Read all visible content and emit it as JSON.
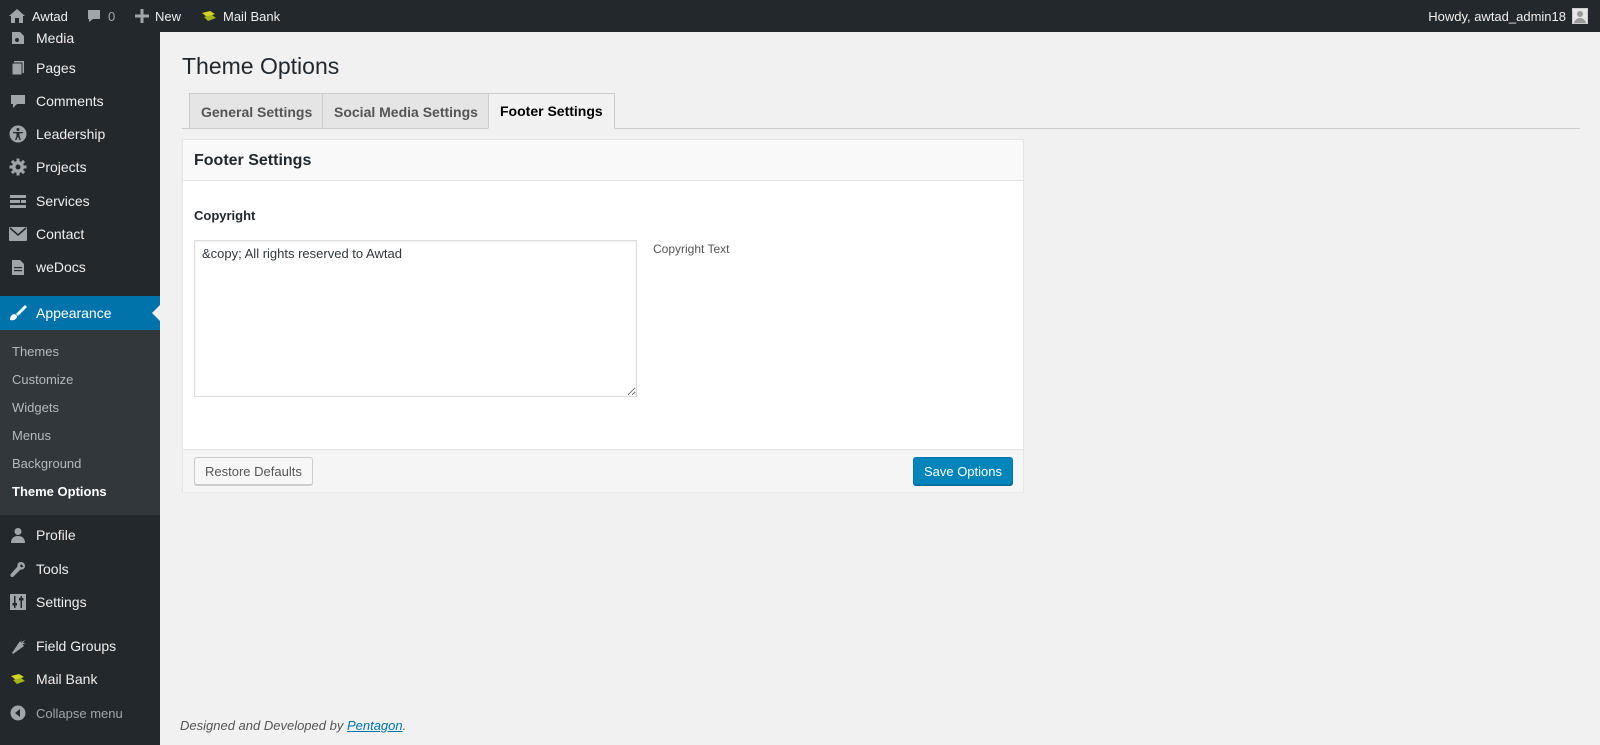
{
  "adminbar": {
    "site_name": "Awtad",
    "comments_count": "0",
    "new_label": "New",
    "mailbank_label": "Mail Bank",
    "howdy": "Howdy, awtad_admin18"
  },
  "sidebar": {
    "items": [
      {
        "label": "Media",
        "icon": "media-icon"
      },
      {
        "label": "Pages",
        "icon": "pages-icon"
      },
      {
        "label": "Comments",
        "icon": "comment-icon"
      },
      {
        "label": "Leadership",
        "icon": "accessibility-icon"
      },
      {
        "label": "Projects",
        "icon": "gear-icon"
      },
      {
        "label": "Services",
        "icon": "services-icon"
      },
      {
        "label": "Contact",
        "icon": "mail-icon"
      },
      {
        "label": "weDocs",
        "icon": "document-icon"
      },
      {
        "label": "Appearance",
        "icon": "paintbrush-icon"
      },
      {
        "label": "Profile",
        "icon": "user-icon"
      },
      {
        "label": "Tools",
        "icon": "wrench-icon"
      },
      {
        "label": "Settings",
        "icon": "sliders-icon"
      },
      {
        "label": "Field Groups",
        "icon": "carrot-icon"
      },
      {
        "label": "Mail Bank",
        "icon": "mailbank-icon"
      },
      {
        "label": "Collapse menu",
        "icon": "collapse-icon"
      }
    ],
    "submenu": [
      "Themes",
      "Customize",
      "Widgets",
      "Menus",
      "Background",
      "Theme Options"
    ]
  },
  "main": {
    "title": "Theme Options",
    "tabs": [
      "General Settings",
      "Social Media Settings",
      "Footer Settings"
    ],
    "panel": {
      "title": "Footer Settings",
      "field_label": "Copyright",
      "field_value": "&copy; All rights reserved to Awtad",
      "field_desc": "Copyright Text",
      "restore_label": "Restore Defaults",
      "save_label": "Save Options"
    }
  },
  "footer": {
    "prefix": "Designed and Developed by ",
    "link": "Pentagon",
    "suffix": "."
  },
  "colors": {
    "adminbar_bg": "#23282d",
    "accent": "#0073aa",
    "save_button": "#0085ba"
  }
}
